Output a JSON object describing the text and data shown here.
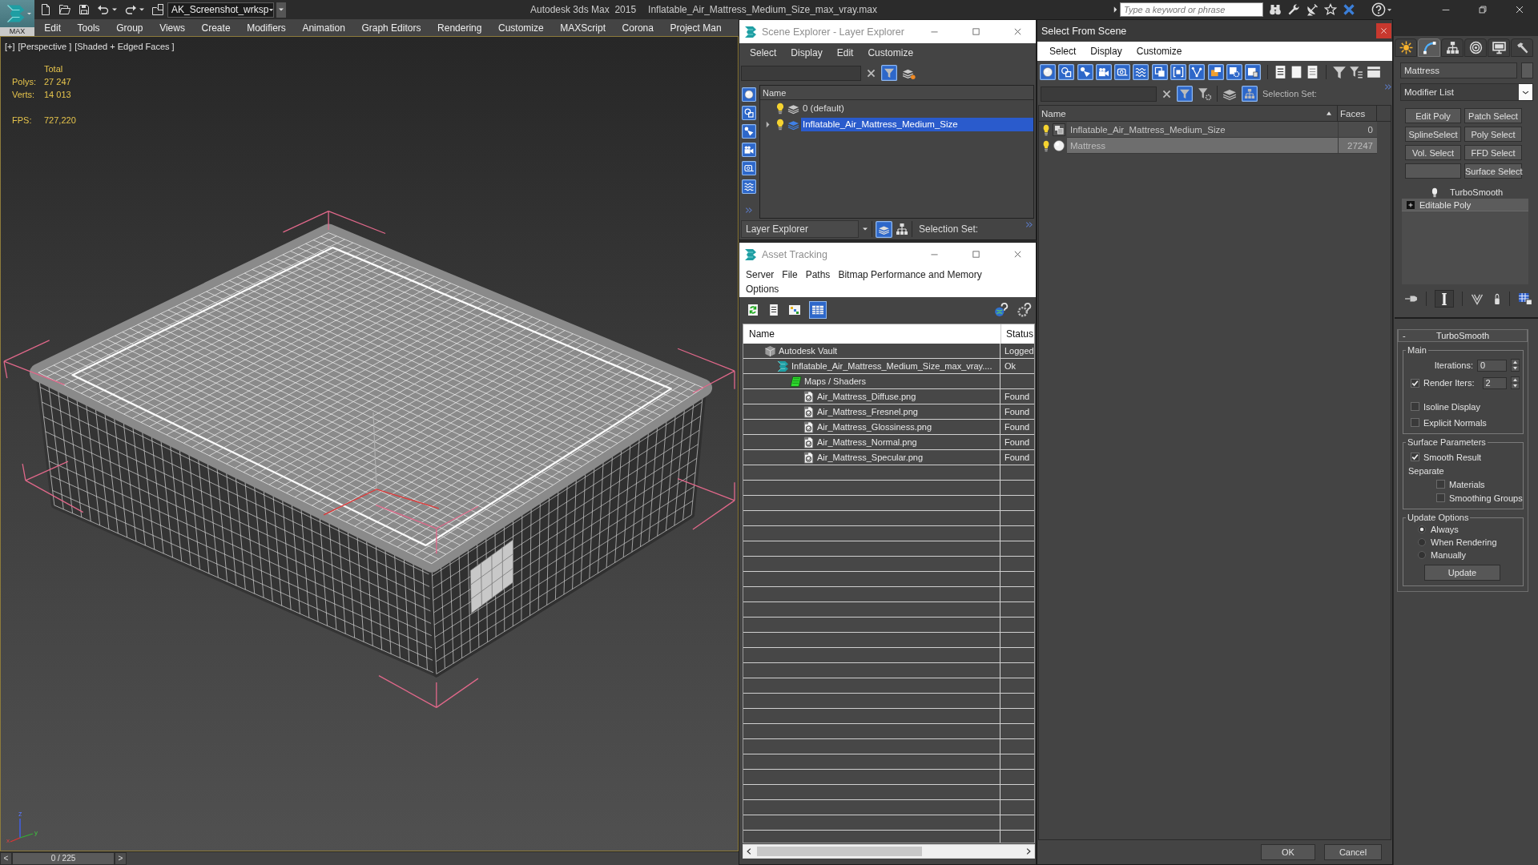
{
  "app_button": {
    "label": "MAX"
  },
  "title_bar": {
    "workspace": "AK_Screenshot_wrksp",
    "app_name": "Autodesk 3ds Max  2015",
    "file_name": "Inflatable_Air_Mattress_Medium_Size_max_vray.max",
    "search": {
      "placeholder": "Type a keyword or phrase"
    }
  },
  "menu_bar": [
    "Edit",
    "Tools",
    "Group",
    "Views",
    "Create",
    "Modifiers",
    "Animation",
    "Graph Editors",
    "Rendering",
    "Customize",
    "MAXScript",
    "Corona",
    "Project Man"
  ],
  "viewport": {
    "labels": [
      "[+]",
      "[Perspective ]",
      "[Shaded + Edged Faces ]"
    ],
    "stats_header": "Total",
    "stats": [
      {
        "label": "Polys:",
        "value": "27 247"
      },
      {
        "label": "Verts:",
        "value": "14 013"
      }
    ],
    "fps": {
      "label": "FPS:",
      "value": "727,220"
    },
    "axes": [
      "z",
      "x",
      "y"
    ]
  },
  "time_slider": {
    "prev": "<",
    "position": "0 / 225",
    "next": ">"
  },
  "scene_explorer": {
    "title": "Scene Explorer - Layer Explorer",
    "menu": [
      "Select",
      "Display",
      "Edit",
      "Customize"
    ],
    "column": "Name",
    "layers": [
      {
        "name": "0 (default)",
        "has_children": false,
        "selected": false
      },
      {
        "name": "Inflatable_Air_Mattress_Medium_Size",
        "has_children": true,
        "selected": true
      }
    ],
    "mode": "Layer Explorer",
    "selection_set_label": "Selection Set:"
  },
  "asset_tracking": {
    "title": "Asset Tracking",
    "menu": [
      "Server",
      "File",
      "Paths",
      "Bitmap Performance and Memory",
      "Options"
    ],
    "columns": [
      "Name",
      "Status"
    ],
    "tree": [
      {
        "kind": "vault",
        "name": "Autodesk Vault",
        "status": "Logged",
        "children": [
          {
            "kind": "scene",
            "name": "Inflatable_Air_Mattress_Medium_Size_max_vray....",
            "status": "Ok",
            "children": [
              {
                "kind": "folder",
                "name": "Maps / Shaders",
                "children": [
                  {
                    "kind": "bitmap",
                    "name": "Air_Mattress_Diffuse.png",
                    "status": "Found"
                  },
                  {
                    "kind": "bitmap",
                    "name": "Air_Mattress_Fresnel.png",
                    "status": "Found"
                  },
                  {
                    "kind": "bitmap",
                    "name": "Air_Mattress_Glossiness.png",
                    "status": "Found"
                  },
                  {
                    "kind": "bitmap",
                    "name": "Air_Mattress_Normal.png",
                    "status": "Found"
                  },
                  {
                    "kind": "bitmap",
                    "name": "Air_Mattress_Specular.png",
                    "status": "Found"
                  }
                ]
              }
            ]
          }
        ]
      }
    ]
  },
  "select_from_scene": {
    "title": "Select From Scene",
    "menu": [
      "Select",
      "Display",
      "Customize"
    ],
    "selection_set_label": "Selection Set:",
    "columns": [
      "Name",
      "Faces"
    ],
    "rows": [
      {
        "kind": "group",
        "name": "Inflatable_Air_Mattress_Medium_Size",
        "faces": "0",
        "selected": false
      },
      {
        "kind": "geometry",
        "name": "Mattress",
        "faces": "27247",
        "selected": true
      }
    ],
    "buttons": [
      "OK",
      "Cancel"
    ]
  },
  "command_panel": {
    "tabs": [
      {
        "kind": "create",
        "selected": false
      },
      {
        "kind": "modify",
        "selected": true
      },
      {
        "kind": "hierarchy",
        "selected": false
      },
      {
        "kind": "motion",
        "selected": false
      },
      {
        "kind": "display",
        "selected": false
      },
      {
        "kind": "utilities",
        "selected": false
      }
    ],
    "object_name": "Mattress",
    "modifier_list": "Modifier List",
    "modifier_sets": [
      [
        "Edit Poly",
        "Patch Select"
      ],
      [
        "SplineSelect",
        "Poly Select"
      ],
      [
        "Vol. Select",
        "FFD Select"
      ],
      [
        "Surface Select"
      ]
    ],
    "stack": [
      {
        "kind": "modifier",
        "name": "TurboSmooth",
        "selected": false
      },
      {
        "kind": "base",
        "name": "Editable Poly",
        "selected": true
      }
    ],
    "rollout": {
      "toggle": "-",
      "title": "TurboSmooth",
      "groups": [
        {
          "title": "Main",
          "items": [
            {
              "kind": "spinner",
              "label": "Iterations:",
              "value": "0"
            },
            {
              "kind": "check_spinner",
              "label": "Render Iters:",
              "value": "2",
              "checked": true
            },
            {
              "kind": "checkbox",
              "label": "Isoline Display",
              "checked": false
            },
            {
              "kind": "checkbox",
              "label": "Explicit Normals",
              "checked": false
            }
          ]
        },
        {
          "title": "Surface Parameters",
          "items": [
            {
              "kind": "checkbox",
              "label": "Smooth Result",
              "checked": true
            },
            {
              "kind": "label",
              "label": "Separate",
              "children": [
                {
                  "kind": "checkbox",
                  "label": "Materials",
                  "checked": false
                },
                {
                  "kind": "checkbox",
                  "label": "Smoothing Groups",
                  "checked": false
                }
              ]
            }
          ]
        },
        {
          "title": "Update Options",
          "items": [
            {
              "kind": "radio",
              "label": "Always",
              "selected": true
            },
            {
              "kind": "radio",
              "label": "When Rendering",
              "selected": false
            },
            {
              "kind": "radio",
              "label": "Manually",
              "selected": false
            },
            {
              "kind": "button",
              "label": "Update"
            }
          ]
        }
      ]
    }
  }
}
